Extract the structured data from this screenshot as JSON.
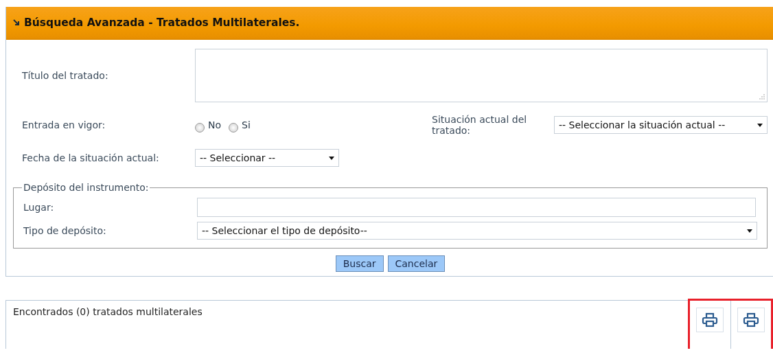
{
  "panel": {
    "title": "Búsqueda Avanzada - Tratados Multilaterales."
  },
  "form": {
    "title_label": "Título del tratado:",
    "entry_label": "Entrada en vigor:",
    "entry_options": [
      {
        "label": "No",
        "selected": false
      },
      {
        "label": "Si",
        "selected": false
      }
    ],
    "status_label": "Situación actual del tratado:",
    "status_select": "-- Seleccionar la situación actual --",
    "date_label": "Fecha de la situación actual:",
    "date_select": "-- Seleccionar --",
    "deposit": {
      "legend": "Depósito del instrumento:",
      "place_label": "Lugar:",
      "type_label": "Tipo de depósito:",
      "type_select": "-- Seleccionar el tipo de depósito--"
    },
    "buttons": [
      "Buscar",
      "Cancelar"
    ]
  },
  "results": {
    "summary": "Encontrados (0) tratados multilaterales",
    "tools": [
      {
        "kind": "print"
      },
      {
        "kind": "print"
      }
    ]
  }
}
